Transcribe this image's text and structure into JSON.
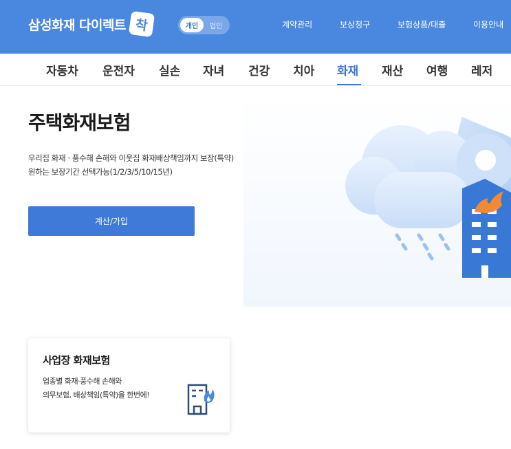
{
  "header": {
    "logo_text": "삼성화재 다이렉트",
    "logo_badge": "착",
    "toggle": {
      "personal": "개인",
      "business": "법인"
    },
    "nav": [
      "계약관리",
      "보상청구",
      "보험상품/대출",
      "이용안내"
    ]
  },
  "categories": {
    "items": [
      "자동차",
      "운전자",
      "실손",
      "자녀",
      "건강",
      "치아",
      "화재",
      "재산",
      "여행",
      "레저"
    ],
    "active": "화재"
  },
  "hero": {
    "title": "주택화재보험",
    "desc1": "우리집 화재 · 풍수해 손해와 이웃집 화재배상책임까지 보장(특약)",
    "desc2": "원하는 보장기간 선택가능(1/2/3/5/10/15년)",
    "cta": "계산/가입"
  },
  "card": {
    "title": "사업장 화재보험",
    "desc1": "업종별 화재·풍수해 손해와",
    "desc2": "의무보험, 배상책임(특약)을 한번에!"
  },
  "colors": {
    "brand_blue": "#4a87de",
    "accent_blue": "#3a78d6",
    "button_blue": "#3f7ad9",
    "flame_orange": "#f28a35"
  },
  "icons": {
    "illustration": "rain-cloud-building-fire",
    "card_icon": "building-flame-icon"
  }
}
